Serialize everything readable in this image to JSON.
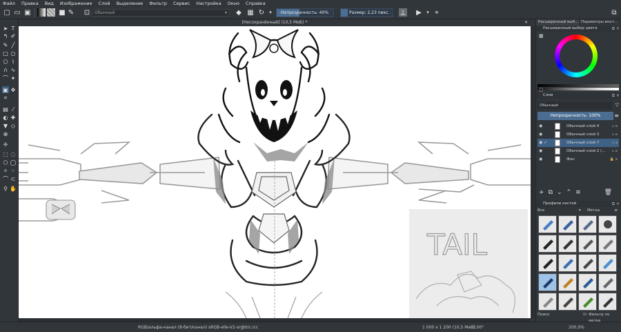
{
  "menu": [
    "Файл",
    "Правка",
    "Вид",
    "Изображение",
    "Слой",
    "Выделение",
    "Фильтр",
    "Сервис",
    "Настройка",
    "Окно",
    "Справка"
  ],
  "toolbar": {
    "blend_mode": "Обычный",
    "opacity_label": "Непрозрачность: 40%",
    "opacity_value": 0.4,
    "size_label": "Размер: 2,23 пикс."
  },
  "canvas": {
    "title": "[Несохранённый]  (10,5 МиБ) *",
    "reference_text": "TAIL"
  },
  "status": {
    "color_profile": "RGB/альфа-канал (8-бит/канал)  sRGB-elle-V2-srgbtrc.icc",
    "image_size": "1 000 x 1 200 (10,5 МиБ)",
    "rotation": "0,00°",
    "zoom": "200,0%"
  },
  "dock": {
    "tabs": [
      "Расширенный выб...",
      "Параметры инст..."
    ],
    "color_panel_title": "Расширенный выбор цвета",
    "layers_panel_title": "Слои",
    "layer_blend": "Обычный",
    "layer_opacity": "Непрозрачность:  100%",
    "layers": [
      {
        "name": "Обычный слой 4",
        "selected": false
      },
      {
        "name": "Обычный слой 3",
        "selected": false
      },
      {
        "name": "Обычный слой 7",
        "selected": true
      },
      {
        "name": "Обычный слой 2 (...",
        "selected": false
      },
      {
        "name": "Фон",
        "selected": false
      }
    ],
    "brush_panel_title": "Профили кистей",
    "brush_filter_all": "Все",
    "brush_tag": "Метка",
    "brush_search": "Поиск",
    "brush_filter_tag": "Фильтр по метке"
  }
}
